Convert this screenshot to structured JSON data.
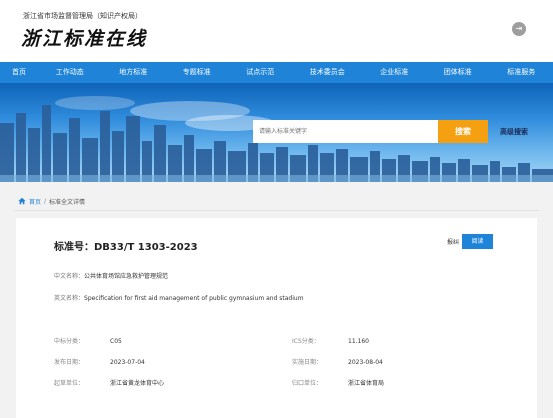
{
  "header": {
    "org": "浙江省市场监督管理局（知识产权局）",
    "title": "浙江标准在线",
    "exit_icon": "exit-icon"
  },
  "nav": {
    "items": [
      "首页",
      "工作动态",
      "地方标准",
      "专题标准",
      "试点示范",
      "技术委员会",
      "企业标准",
      "团体标准",
      "标准服务"
    ]
  },
  "search": {
    "placeholder": "请输入标准关键字",
    "button": "搜索",
    "advanced": "高级搜索"
  },
  "breadcrumb": {
    "home": "首页",
    "sep": "/",
    "current": "标准全文详情"
  },
  "detail": {
    "label": "标准号：",
    "code": "DB33/T 1303-2023",
    "report": "报纠",
    "read": "阅读",
    "cn_name_label": "中文名称：",
    "cn_name": "公共体育场馆应急救护管理规范",
    "en_name_label": "英文名称：",
    "en_name": "Specification for first aid management of public gymnasium and stadium",
    "fields": {
      "ccs_label": "中标分类：",
      "ccs": "C05",
      "ics_label": "ICS分类：",
      "ics": "11.160",
      "publish_label": "发布日期：",
      "publish": "2023-07-04",
      "impl_label": "实施日期：",
      "impl": "2023-08-04",
      "drafter_label": "起草单位：",
      "drafter": "浙江省黄龙体育中心",
      "owner_label": "归口单位：",
      "owner": "浙江省体育局"
    }
  },
  "colors": {
    "nav": "#1f84d8",
    "search_button": "#f5a011",
    "read_button": "#1f84d8"
  }
}
